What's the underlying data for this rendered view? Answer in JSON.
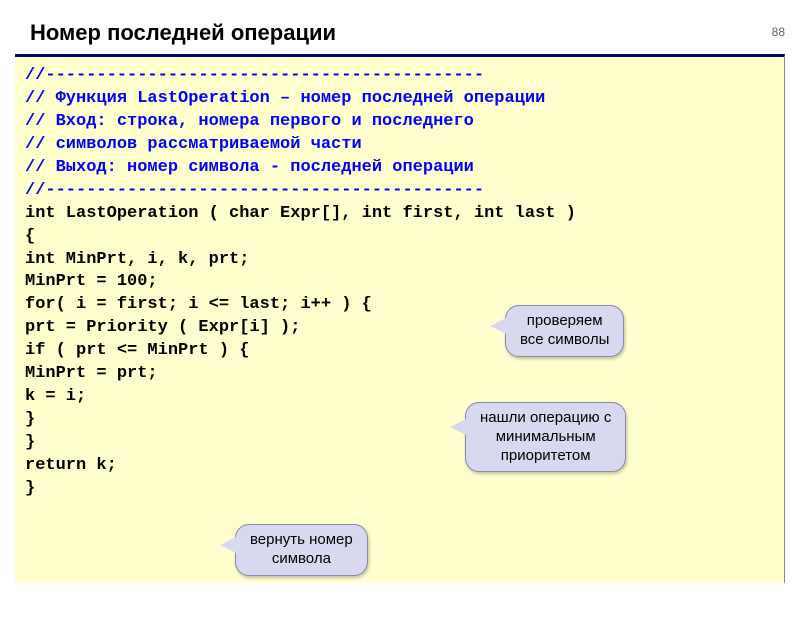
{
  "page_number": "88",
  "title": "Номер последней операции",
  "code": {
    "c1": "//-------------------------------------------",
    "c2": "// Функция LastOperation – номер последней операции",
    "c3": "// Вход:  строка, номера первого и последнего",
    "c4": "//        символов рассматриваемой части",
    "c5": "// Выход: номер символа - последней операции",
    "c6": "//-------------------------------------------",
    "l1": "int LastOperation ( char Expr[], int first, int last )",
    "l2": "{",
    "l3": "   int MinPrt, i, k, prt;",
    "l4": "   MinPrt = 100;",
    "l5": "   for( i = first; i <= last; i++ ) {",
    "l6": "     prt = Priority ( Expr[i] );",
    "l7": "     if ( prt <= MinPrt ) {",
    "l8": "       MinPrt = prt;",
    "l9": "       k = i;",
    "l10": "       }",
    "l11": "     }",
    "l12": "   return k;",
    "l13": "}"
  },
  "callouts": {
    "c1_line1": "проверяем",
    "c1_line2": "все символы",
    "c2_line1": "нашли операцию с",
    "c2_line2": "минимальным",
    "c2_line3": "приоритетом",
    "c3_line1": "вернуть номер",
    "c3_line2": "символа"
  }
}
